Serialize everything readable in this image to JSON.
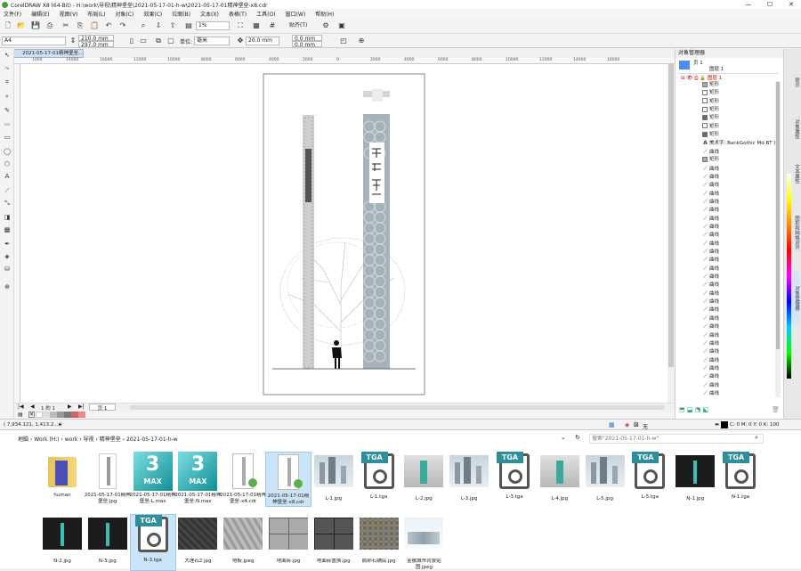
{
  "titlebar": {
    "title": "CorelDRAW X8 (64-Bit) - H:\\work\\导视\\精神堡垒\\2021-05-17-01-h-w\\2021-05-17-01精神堡垒-x8.cdr",
    "min": "—",
    "max": "☐",
    "close": "✕"
  },
  "menu": [
    "文件(F)",
    "编辑(E)",
    "视图(V)",
    "布局(L)",
    "对象(C)",
    "效果(C)",
    "位图(B)",
    "文本(X)",
    "表格(T)",
    "工具(O)",
    "窗口(W)",
    "帮助(H)"
  ],
  "toolbar1": {
    "zoom": "1%",
    "snap": "贴齐(T)"
  },
  "toolbar2": {
    "paper": "A4",
    "width": "210.0 mm",
    "height": "297.0 mm",
    "unit_label": "单位:",
    "unit": "毫米",
    "nudge": "20.0 mm",
    "dup_x": "0.0 mm",
    "dup_y": "0.0 mm"
  },
  "doc_tab": "2021-05-17-01精神堡垒...",
  "ruler_ticks": [
    "1000",
    "14000",
    "16000",
    "12000",
    "10000",
    "8000",
    "6000",
    "4000",
    "2000",
    "0",
    "2000",
    "4000",
    "6000",
    "8000",
    "10000",
    "12000",
    "14000",
    "16000"
  ],
  "pagebar": {
    "page_of": "1 的 1",
    "page_tab": "页 1"
  },
  "statusbar": {
    "coords": "( 7,934.121, 1,413.2... )",
    "fill": "无",
    "color_info": "C: 0 M: 0 Y: 0 K: 100"
  },
  "object_manager": {
    "title": "对象管理器",
    "page": "页 1",
    "layer_top": "图层 1",
    "layer1": "图层 1",
    "rows": [
      "矩形",
      "矩形",
      "矩形",
      "矩形",
      "矩形",
      "矩形",
      "矩形",
      "美术字: BankGothic Md BT (",
      "曲线",
      "矩形",
      "曲线",
      "曲线",
      "曲线",
      "曲线",
      "曲线",
      "曲线",
      "曲线",
      "曲线",
      "曲线",
      "曲线",
      "曲线",
      "曲线",
      "曲线",
      "曲线",
      "曲线",
      "曲线",
      "曲线",
      "曲线",
      "曲线",
      "曲线",
      "曲线",
      "曲线",
      "曲线",
      "曲线",
      "曲线",
      "曲线",
      "曲线",
      "曲线"
    ]
  },
  "side_tabs": [
    "提示",
    "对象属性",
    "文本属性",
    "图形和网格对齐",
    "对象管理器"
  ],
  "explorer": {
    "breadcrumb": [
      "地脑",
      "Work (H:)",
      "work",
      "导视",
      "精神堡垒",
      "2021-05-17-01-h-w"
    ],
    "search_placeholder": "搜索\"2021-05-17-01-h-w\"",
    "files_row1": [
      {
        "name": "human",
        "kind": "folder"
      },
      {
        "name": "2021-05-17-01精神堡垒.jpg",
        "kind": "render-white"
      },
      {
        "name": "2021-05-17-01精神堡垒-L.max",
        "kind": "max"
      },
      {
        "name": "2021-05-17-01精神堡垒-N.max",
        "kind": "max"
      },
      {
        "name": "2021-05-17-01精神堡垒-x4.cdr",
        "kind": "cdr"
      },
      {
        "name": "2021-05-17-01精神堡垒-x8.cdr",
        "kind": "cdr-selected"
      },
      {
        "name": "L-1.jpg",
        "kind": "city"
      },
      {
        "name": "L-1.tga",
        "kind": "tga"
      },
      {
        "name": "L-2.jpg",
        "kind": "grey"
      },
      {
        "name": "L-3.jpg",
        "kind": "city"
      },
      {
        "name": "L-3.tga",
        "kind": "tga"
      },
      {
        "name": "L-4.jpg",
        "kind": "grey"
      },
      {
        "name": "L-5.jpg",
        "kind": "city"
      },
      {
        "name": "L-5.tga",
        "kind": "tga"
      },
      {
        "name": "N-1.jpg",
        "kind": "dark"
      },
      {
        "name": "N-1.tga",
        "kind": "tga"
      }
    ],
    "files_row2": [
      {
        "name": "N-2.jpg",
        "kind": "dark"
      },
      {
        "name": "N-3.jpg",
        "kind": "dark"
      },
      {
        "name": "N-3.tga",
        "kind": "tga-selected"
      },
      {
        "name": "大理石2.jpg",
        "kind": "texture-dark"
      },
      {
        "name": "地板.jpeg",
        "kind": "texture-light"
      },
      {
        "name": "地面砖.jpg",
        "kind": "tiles"
      },
      {
        "name": "地面砖置换.jpg",
        "kind": "tiles-dark"
      },
      {
        "name": "鹅卵石铺底.jpg",
        "kind": "pebbles"
      },
      {
        "name": "金融城市背景贴图.jpeg",
        "kind": "skyline"
      }
    ]
  },
  "colors": {
    "accent": "#2c8f9a",
    "selection": "#cce4f7",
    "panel_bg": "#4c8bf5",
    "pillar": "#a7b3ba"
  }
}
